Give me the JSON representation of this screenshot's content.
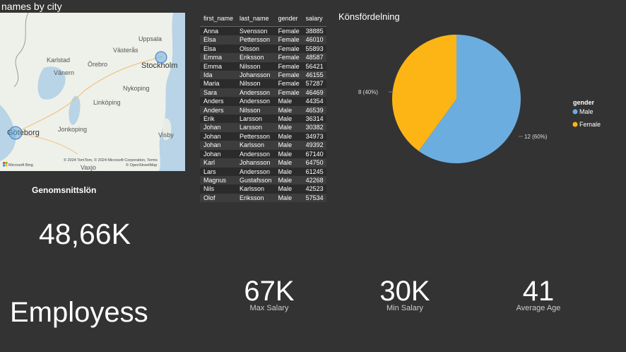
{
  "map": {
    "title": "names by city",
    "places": [
      "Uppsala",
      "Västerås",
      "Karlstad",
      "Örebro",
      "Stockholm",
      "Vänern",
      "Nykoping",
      "Linköping",
      "Göteborg",
      "Jonkoping",
      "Visby",
      "Vaxjo"
    ],
    "attribution": "© 2024 TomTom, © 2024 Microsoft Corporation, Terms",
    "attribution2": "© OpenStreetMap",
    "brand": "Microsoft Bing"
  },
  "table": {
    "columns": [
      "first_name",
      "last_name",
      "gender",
      "salary"
    ],
    "rows": [
      [
        "Anna",
        "Svensson",
        "Female",
        "38885"
      ],
      [
        "Elsa",
        "Pettersson",
        "Female",
        "46010"
      ],
      [
        "Elsa",
        "Olsson",
        "Female",
        "55893"
      ],
      [
        "Emma",
        "Eriksson",
        "Female",
        "48587"
      ],
      [
        "Emma",
        "Nilsson",
        "Female",
        "56421"
      ],
      [
        "Ida",
        "Johansson",
        "Female",
        "46155"
      ],
      [
        "Maria",
        "Nilsson",
        "Female",
        "57287"
      ],
      [
        "Sara",
        "Andersson",
        "Female",
        "46469"
      ],
      [
        "Anders",
        "Andersson",
        "Male",
        "44354"
      ],
      [
        "Anders",
        "Nilsson",
        "Male",
        "46539"
      ],
      [
        "Erik",
        "Larsson",
        "Male",
        "36314"
      ],
      [
        "Johan",
        "Larsson",
        "Male",
        "30382"
      ],
      [
        "Johan",
        "Pettersson",
        "Male",
        "34973"
      ],
      [
        "Johan",
        "Karlsson",
        "Male",
        "49392"
      ],
      [
        "Johan",
        "Andersson",
        "Male",
        "67140"
      ],
      [
        "Karl",
        "Johansson",
        "Male",
        "64750"
      ],
      [
        "Lars",
        "Andersson",
        "Male",
        "61245"
      ],
      [
        "Magnus",
        "Gustafsson",
        "Male",
        "42268"
      ],
      [
        "Nils",
        "Karlsson",
        "Male",
        "42523"
      ],
      [
        "Olof",
        "Eriksson",
        "Male",
        "57534"
      ]
    ]
  },
  "pie": {
    "title": "Könsfördelning",
    "legend_title": "gender",
    "male_label": "12 (60%)",
    "female_label": "8 (40%)"
  },
  "chart_data": {
    "type": "pie",
    "title": "Könsfördelning",
    "legend_title": "gender",
    "legend_position": "right",
    "series": [
      {
        "name": "Male",
        "value": 12,
        "percent": 60,
        "color": "#6CADDF"
      },
      {
        "name": "Female",
        "value": 8,
        "percent": 40,
        "color": "#FDB515"
      }
    ]
  },
  "cards": {
    "avg_title": "Genomsnittslön",
    "avg_value": "48,66K",
    "employees_title": "Employess",
    "max_value": "67K",
    "max_label": "Max Salary",
    "min_value": "30K",
    "min_label": "Min Salary",
    "age_value": "41",
    "age_label": "Average Age"
  }
}
